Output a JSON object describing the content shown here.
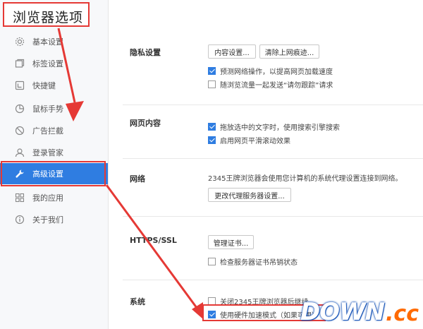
{
  "window": {
    "title": "浏览器选项"
  },
  "sidebar": {
    "items": [
      {
        "label": "基本设置",
        "icon": "gear-icon"
      },
      {
        "label": "标签设置",
        "icon": "tabs-icon"
      },
      {
        "label": "快捷键",
        "icon": "keyboard-icon"
      },
      {
        "label": "鼠标手势",
        "icon": "mouse-icon"
      },
      {
        "label": "广告拦截",
        "icon": "block-icon"
      },
      {
        "label": "登录管家",
        "icon": "user-icon"
      },
      {
        "label": "高级设置",
        "icon": "wrench-icon",
        "active": true
      },
      {
        "label": "我的应用",
        "icon": "apps-icon"
      },
      {
        "label": "关于我们",
        "icon": "info-icon"
      }
    ]
  },
  "privacy": {
    "title": "隐私设置",
    "content_settings_button": "内容设置...",
    "clear_history_button": "清除上网痕迹...",
    "predict_network": {
      "label": "预测网络操作，以提高网页加载速度",
      "checked": true
    },
    "do_not_track": {
      "label": "随浏览流量一起发送“请勿跟踪”请求",
      "checked": false
    }
  },
  "web_content": {
    "title": "网页内容",
    "drag_search": {
      "label": "拖放选中的文字时，使用搜索引擎搜索",
      "checked": true
    },
    "smooth_scroll": {
      "label": "启用网页平滑滚动效果",
      "checked": true
    }
  },
  "network": {
    "title": "网络",
    "description": "2345王牌浏览器会使用您计算机的系统代理设置连接到网络。",
    "proxy_button": "更改代理服务器设置..."
  },
  "https": {
    "title": "HTTPS/SSL",
    "manage_certs_button": "管理证书...",
    "check_revocation": {
      "label": "检查服务器证书吊销状态",
      "checked": false
    }
  },
  "system": {
    "title": "系统",
    "run_background": {
      "label": "关闭2345王牌浏览器后继续",
      "checked": false
    },
    "hardware_accel": {
      "label": "使用硬件加速模式（如果可用）",
      "checked": true
    }
  },
  "watermark": {
    "main": "DOWN",
    "suffix": ".cc"
  },
  "colors": {
    "accent": "#2f7de1",
    "annotation": "#e53935"
  }
}
